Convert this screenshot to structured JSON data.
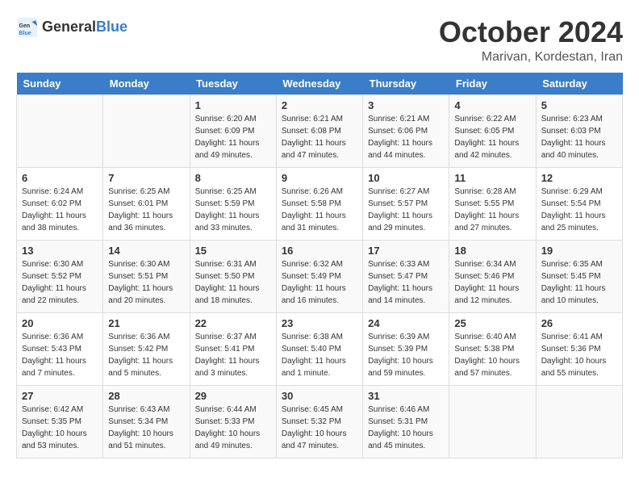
{
  "logo": {
    "text1": "General",
    "text2": "Blue"
  },
  "title": "October 2024",
  "location": "Marivan, Kordestan, Iran",
  "weekdays": [
    "Sunday",
    "Monday",
    "Tuesday",
    "Wednesday",
    "Thursday",
    "Friday",
    "Saturday"
  ],
  "weeks": [
    [
      {
        "day": "",
        "info": ""
      },
      {
        "day": "",
        "info": ""
      },
      {
        "day": "1",
        "info": "Sunrise: 6:20 AM\nSunset: 6:09 PM\nDaylight: 11 hours and 49 minutes."
      },
      {
        "day": "2",
        "info": "Sunrise: 6:21 AM\nSunset: 6:08 PM\nDaylight: 11 hours and 47 minutes."
      },
      {
        "day": "3",
        "info": "Sunrise: 6:21 AM\nSunset: 6:06 PM\nDaylight: 11 hours and 44 minutes."
      },
      {
        "day": "4",
        "info": "Sunrise: 6:22 AM\nSunset: 6:05 PM\nDaylight: 11 hours and 42 minutes."
      },
      {
        "day": "5",
        "info": "Sunrise: 6:23 AM\nSunset: 6:03 PM\nDaylight: 11 hours and 40 minutes."
      }
    ],
    [
      {
        "day": "6",
        "info": "Sunrise: 6:24 AM\nSunset: 6:02 PM\nDaylight: 11 hours and 38 minutes."
      },
      {
        "day": "7",
        "info": "Sunrise: 6:25 AM\nSunset: 6:01 PM\nDaylight: 11 hours and 36 minutes."
      },
      {
        "day": "8",
        "info": "Sunrise: 6:25 AM\nSunset: 5:59 PM\nDaylight: 11 hours and 33 minutes."
      },
      {
        "day": "9",
        "info": "Sunrise: 6:26 AM\nSunset: 5:58 PM\nDaylight: 11 hours and 31 minutes."
      },
      {
        "day": "10",
        "info": "Sunrise: 6:27 AM\nSunset: 5:57 PM\nDaylight: 11 hours and 29 minutes."
      },
      {
        "day": "11",
        "info": "Sunrise: 6:28 AM\nSunset: 5:55 PM\nDaylight: 11 hours and 27 minutes."
      },
      {
        "day": "12",
        "info": "Sunrise: 6:29 AM\nSunset: 5:54 PM\nDaylight: 11 hours and 25 minutes."
      }
    ],
    [
      {
        "day": "13",
        "info": "Sunrise: 6:30 AM\nSunset: 5:52 PM\nDaylight: 11 hours and 22 minutes."
      },
      {
        "day": "14",
        "info": "Sunrise: 6:30 AM\nSunset: 5:51 PM\nDaylight: 11 hours and 20 minutes."
      },
      {
        "day": "15",
        "info": "Sunrise: 6:31 AM\nSunset: 5:50 PM\nDaylight: 11 hours and 18 minutes."
      },
      {
        "day": "16",
        "info": "Sunrise: 6:32 AM\nSunset: 5:49 PM\nDaylight: 11 hours and 16 minutes."
      },
      {
        "day": "17",
        "info": "Sunrise: 6:33 AM\nSunset: 5:47 PM\nDaylight: 11 hours and 14 minutes."
      },
      {
        "day": "18",
        "info": "Sunrise: 6:34 AM\nSunset: 5:46 PM\nDaylight: 11 hours and 12 minutes."
      },
      {
        "day": "19",
        "info": "Sunrise: 6:35 AM\nSunset: 5:45 PM\nDaylight: 11 hours and 10 minutes."
      }
    ],
    [
      {
        "day": "20",
        "info": "Sunrise: 6:36 AM\nSunset: 5:43 PM\nDaylight: 11 hours and 7 minutes."
      },
      {
        "day": "21",
        "info": "Sunrise: 6:36 AM\nSunset: 5:42 PM\nDaylight: 11 hours and 5 minutes."
      },
      {
        "day": "22",
        "info": "Sunrise: 6:37 AM\nSunset: 5:41 PM\nDaylight: 11 hours and 3 minutes."
      },
      {
        "day": "23",
        "info": "Sunrise: 6:38 AM\nSunset: 5:40 PM\nDaylight: 11 hours and 1 minute."
      },
      {
        "day": "24",
        "info": "Sunrise: 6:39 AM\nSunset: 5:39 PM\nDaylight: 10 hours and 59 minutes."
      },
      {
        "day": "25",
        "info": "Sunrise: 6:40 AM\nSunset: 5:38 PM\nDaylight: 10 hours and 57 minutes."
      },
      {
        "day": "26",
        "info": "Sunrise: 6:41 AM\nSunset: 5:36 PM\nDaylight: 10 hours and 55 minutes."
      }
    ],
    [
      {
        "day": "27",
        "info": "Sunrise: 6:42 AM\nSunset: 5:35 PM\nDaylight: 10 hours and 53 minutes."
      },
      {
        "day": "28",
        "info": "Sunrise: 6:43 AM\nSunset: 5:34 PM\nDaylight: 10 hours and 51 minutes."
      },
      {
        "day": "29",
        "info": "Sunrise: 6:44 AM\nSunset: 5:33 PM\nDaylight: 10 hours and 49 minutes."
      },
      {
        "day": "30",
        "info": "Sunrise: 6:45 AM\nSunset: 5:32 PM\nDaylight: 10 hours and 47 minutes."
      },
      {
        "day": "31",
        "info": "Sunrise: 6:46 AM\nSunset: 5:31 PM\nDaylight: 10 hours and 45 minutes."
      },
      {
        "day": "",
        "info": ""
      },
      {
        "day": "",
        "info": ""
      }
    ]
  ]
}
